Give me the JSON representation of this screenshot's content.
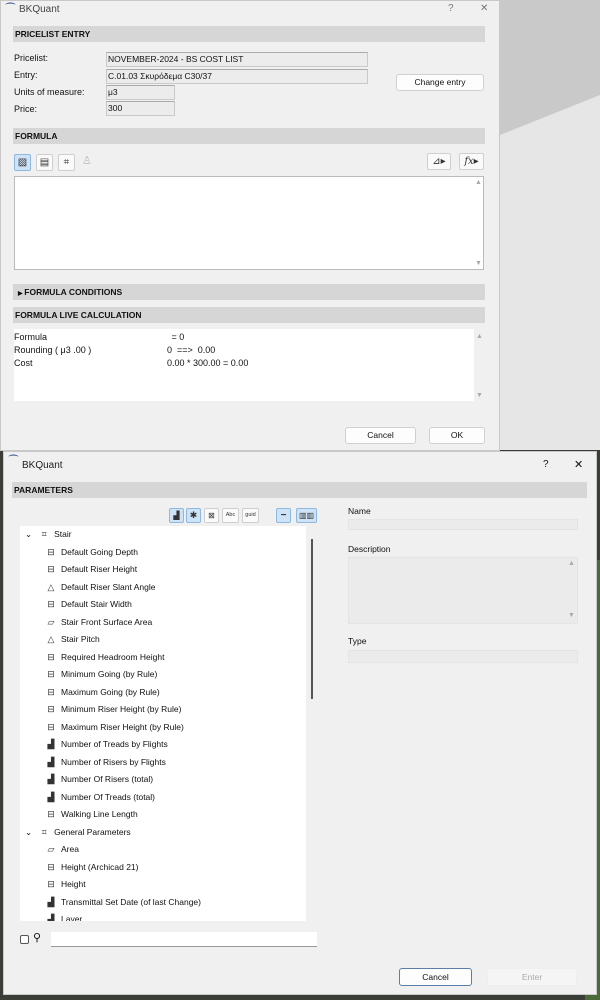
{
  "dialog1": {
    "title": "BKQuant",
    "help": "?",
    "close": "✕",
    "pricelist_header": "PRICELIST ENTRY",
    "fields": [
      {
        "label": "Pricelist:",
        "value": "NOVEMBER-2024  -  BS COST LIST"
      },
      {
        "label": "Entry:",
        "value": "C.01.03  Σκυρόδεμα C30/37"
      },
      {
        "label": "Units of measure:",
        "value": "μ3"
      },
      {
        "label": "Price:",
        "value": "300"
      }
    ],
    "change_entry": "Change entry",
    "formula_header": "FORMULA",
    "formula_value": "",
    "conditions_header": "FORMULA CONDITIONS",
    "live_header": "FORMULA LIVE CALCULATION",
    "live_rows": [
      {
        "label": "Formula",
        "value": " = 0"
      },
      {
        "label": "Rounding ( μ3  .00 )",
        "value": "0  ==>  0.00"
      },
      {
        "label": "Cost",
        "value": "0.00 * 300.00 = 0.00"
      }
    ],
    "cancel": "Cancel",
    "ok": "OK"
  },
  "dialog2": {
    "title": "BKQuant",
    "help": "?",
    "close": "✕",
    "parameters_header": "PARAMETERS",
    "toolbar": [
      "number-filter",
      "angle-filter",
      "boolean-filter",
      "Abc",
      "guid",
      "single-column",
      "multi-column"
    ],
    "toolbar_labels": {
      "abc": "Abc",
      "guid": "guid"
    },
    "tree": [
      {
        "group": "Stair",
        "items": [
          {
            "label": "Default Going Depth",
            "icon": "dimension"
          },
          {
            "label": "Default Riser Height",
            "icon": "dimension"
          },
          {
            "label": "Default Riser Slant Angle",
            "icon": "angle"
          },
          {
            "label": "Default Stair Width",
            "icon": "dimension"
          },
          {
            "label": "Stair Front Surface Area",
            "icon": "area"
          },
          {
            "label": "Stair Pitch",
            "icon": "angle"
          },
          {
            "label": "Required Headroom Height",
            "icon": "dimension"
          },
          {
            "label": "Minimum Going (by Rule)",
            "icon": "dimension"
          },
          {
            "label": "Maximum Going (by Rule)",
            "icon": "dimension"
          },
          {
            "label": "Minimum Riser Height (by Rule)",
            "icon": "dimension"
          },
          {
            "label": "Maximum Riser Height (by Rule)",
            "icon": "dimension"
          },
          {
            "label": "Number of Treads by Flights",
            "icon": "number"
          },
          {
            "label": "Number of Risers by Flights",
            "icon": "number"
          },
          {
            "label": "Number Of Risers (total)",
            "icon": "number"
          },
          {
            "label": "Number Of Treads (total)",
            "icon": "number"
          },
          {
            "label": "Walking Line Length",
            "icon": "dimension"
          }
        ]
      },
      {
        "group": "General Parameters",
        "items": [
          {
            "label": "Area",
            "icon": "area"
          },
          {
            "label": "Height (Archicad 21)",
            "icon": "dimension"
          },
          {
            "label": "Height",
            "icon": "dimension"
          },
          {
            "label": "Transmittal Set Date (of last Change)",
            "icon": "number"
          },
          {
            "label": "Layer",
            "icon": "number"
          }
        ]
      }
    ],
    "name_label": "Name",
    "name_value": "",
    "description_label": "Description",
    "description_value": "",
    "type_label": "Type",
    "type_value": "",
    "search_placeholder": "",
    "cancel": "Cancel",
    "enter": "Enter"
  }
}
